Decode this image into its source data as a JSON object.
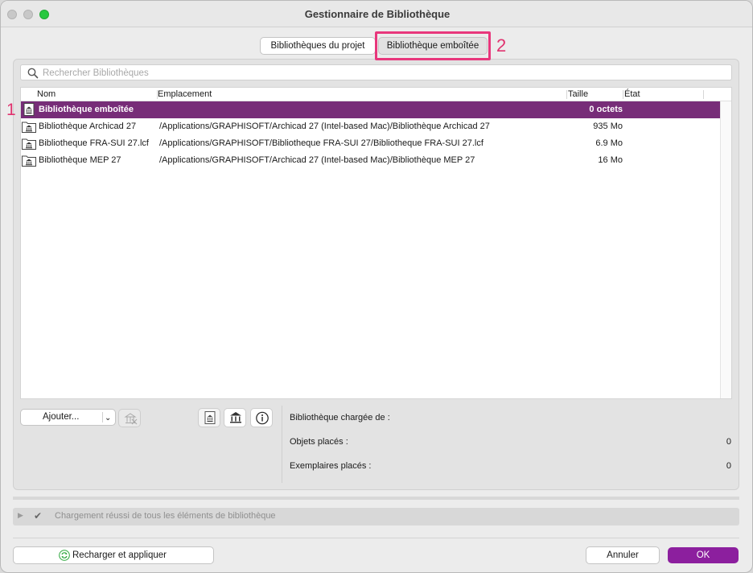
{
  "window": {
    "title": "Gestionnaire de Bibliothèque"
  },
  "tabs": [
    {
      "label": "Bibliothèques du projet",
      "active": false
    },
    {
      "label": "Bibliothèque emboîtée",
      "active": true
    }
  ],
  "markers": {
    "tab": "2",
    "row": "1"
  },
  "search": {
    "placeholder": "Rechercher Bibliothèques",
    "value": ""
  },
  "table": {
    "columns": [
      "Nom",
      "Emplacement",
      "Taille",
      "État"
    ],
    "rows": [
      {
        "icon": "embedded-library-icon",
        "name": "Bibliothèque emboîtée",
        "location": "",
        "size": "0 octets",
        "state": "",
        "selected": true
      },
      {
        "icon": "library-folder-icon",
        "name": "Bibliothèque Archicad 27",
        "location": "/Applications/GRAPHISOFT/Archicad 27 (Intel-based Mac)/Bibliothèque Archicad 27",
        "size": "935 Mo",
        "state": "",
        "selected": false
      },
      {
        "icon": "library-folder-icon",
        "name": "Bibliotheque FRA-SUI 27.lcf",
        "location": "/Applications/GRAPHISOFT/Bibliotheque FRA-SUI 27/Bibliotheque FRA-SUI 27.lcf",
        "size": "6.9 Mo",
        "state": "",
        "selected": false
      },
      {
        "icon": "library-folder-icon",
        "name": "Bibliothèque MEP 27",
        "location": "/Applications/GRAPHISOFT/Archicad 27 (Intel-based Mac)/Bibliothèque MEP 27",
        "size": "16 Mo",
        "state": "",
        "selected": false
      }
    ]
  },
  "toolbar": {
    "add_label": "Ajouter..."
  },
  "info": {
    "loaded_from_label": "Bibliothèque chargée de :",
    "loaded_from_value": "",
    "placed_objects_label": "Objets placés :",
    "placed_objects_value": "0",
    "placed_instances_label": "Exemplaires placés :",
    "placed_instances_value": "0"
  },
  "status": {
    "text": "Chargement réussi de tous les éléments de bibliothèque"
  },
  "footer": {
    "reload_label": "Recharger et appliquer",
    "cancel_label": "Annuler",
    "ok_label": "OK"
  },
  "colors": {
    "selection": "#772d78",
    "primary_button": "#8c1f9e",
    "highlight": "#e8377c"
  }
}
